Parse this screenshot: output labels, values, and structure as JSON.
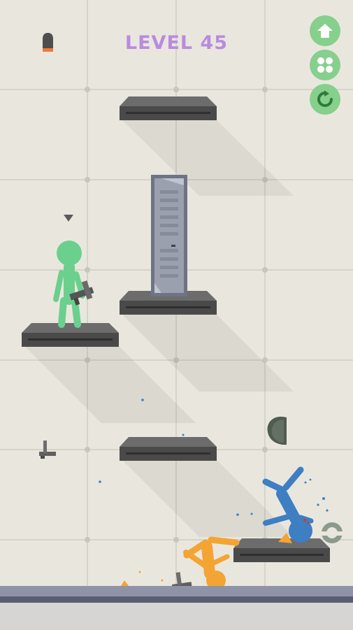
{
  "level_title": "LEVEL 45",
  "ammo_remaining": 1,
  "menu_buttons": [
    {
      "name": "home-button",
      "icon": "home-icon"
    },
    {
      "name": "level-select-button",
      "icon": "grid-dots-icon"
    },
    {
      "name": "restart-button",
      "icon": "restart-icon"
    }
  ],
  "colors": {
    "background": "#e9e7dd",
    "title": "#b98be0",
    "button": "#86cf8d",
    "player": "#6bcf8e",
    "enemy_blue": "#3e7ec3",
    "enemy_orange": "#f3a432",
    "platform": "#4a4a4a",
    "floor": "#8f93a8"
  }
}
